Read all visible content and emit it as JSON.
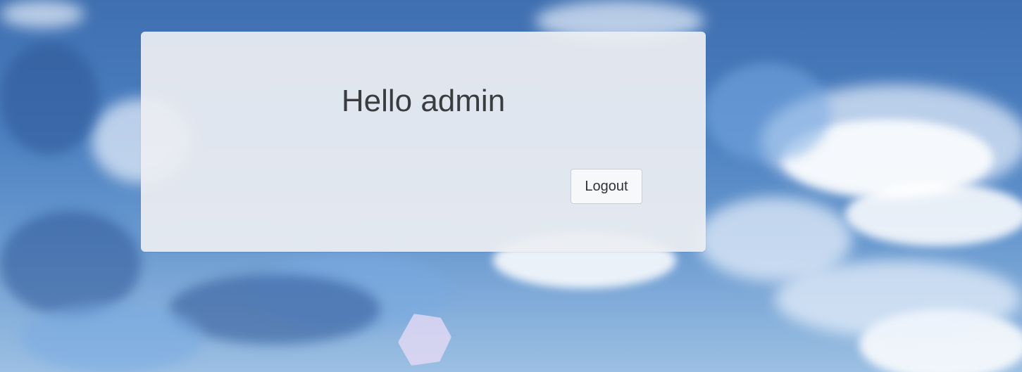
{
  "card": {
    "greeting": "Hello admin",
    "logout_label": "Logout"
  },
  "colors": {
    "sky": "#4b7fc0",
    "card_background": "#eceef2",
    "text": "#3a3d40"
  }
}
